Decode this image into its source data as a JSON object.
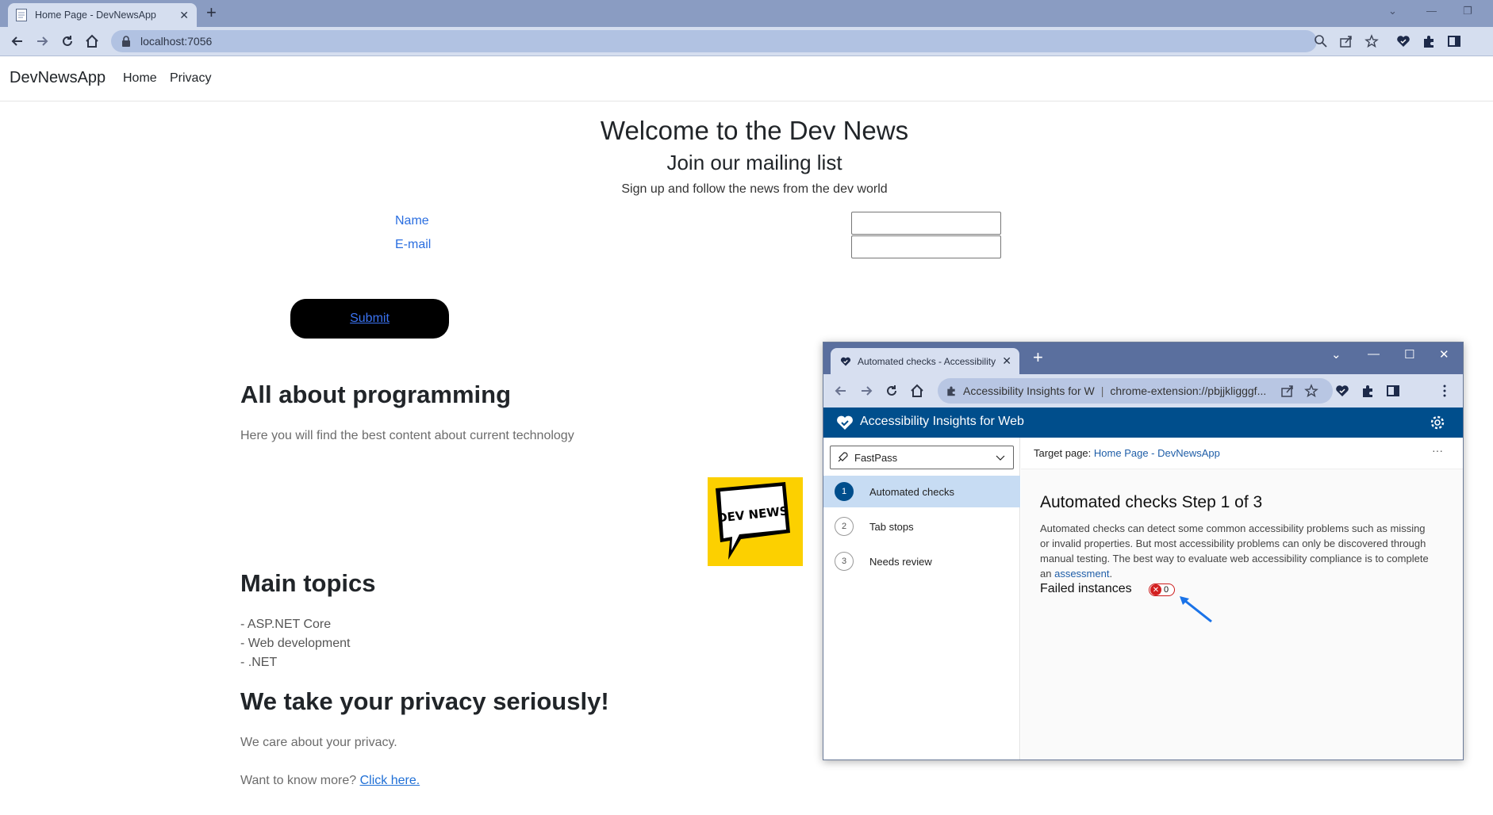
{
  "browser": {
    "tab_title": "Home Page - DevNewsApp",
    "url": "localhost:7056"
  },
  "site": {
    "brand": "DevNewsApp",
    "nav": [
      "Home",
      "Privacy"
    ],
    "title": "Welcome to the Dev News",
    "subtitle": "Join our mailing list",
    "tagline": "Sign up and follow the news from the dev world",
    "form": {
      "name_label": "Name",
      "email_label": "E-mail",
      "name_value": "",
      "email_value": "",
      "submit_label": "Submit"
    },
    "logo_text": "DEV NEWS",
    "sections": {
      "programming_heading": "All about programming",
      "programming_text": "Here you will find the best content about current technology",
      "topics_heading": "Main topics",
      "topics": [
        "- ASP.NET Core",
        "- Web development",
        "- .NET"
      ],
      "privacy_heading": "We take your privacy seriously!",
      "privacy_text": "We care about your privacy.",
      "more_text": "Want to know more?",
      "more_link": "Click here."
    }
  },
  "popup": {
    "tab_title": "Automated checks - Accessibility Insights for Web",
    "omnibox_site": "Accessibility Insights for W",
    "omnibox_url": "chrome-extension://pbjjkligggf...",
    "header_title": "Accessibility Insights for Web",
    "mode": "FastPass",
    "steps": [
      {
        "num": "1",
        "label": "Automated checks"
      },
      {
        "num": "2",
        "label": "Tab stops"
      },
      {
        "num": "3",
        "label": "Needs review"
      }
    ],
    "target_label": "Target page:",
    "target_link": "Home Page - DevNewsApp",
    "more_glyph": "···",
    "heading": "Automated checks Step 1 of 3",
    "description": "Automated checks can detect some common accessibility problems such as missing or invalid properties. But most accessibility problems can only be discovered through manual testing. The best way to evaluate web accessibility compliance is to complete an",
    "description_link": "assessment",
    "description_end": ".",
    "failed_label": "Failed instances",
    "failed_count": "0"
  },
  "colors": {
    "browser_tabbar": "#8a9cc2",
    "link_blue": "#1f6fd6",
    "insights_blue": "#004e8c",
    "error_red": "#d32020",
    "logo_yellow": "#fcd000"
  }
}
